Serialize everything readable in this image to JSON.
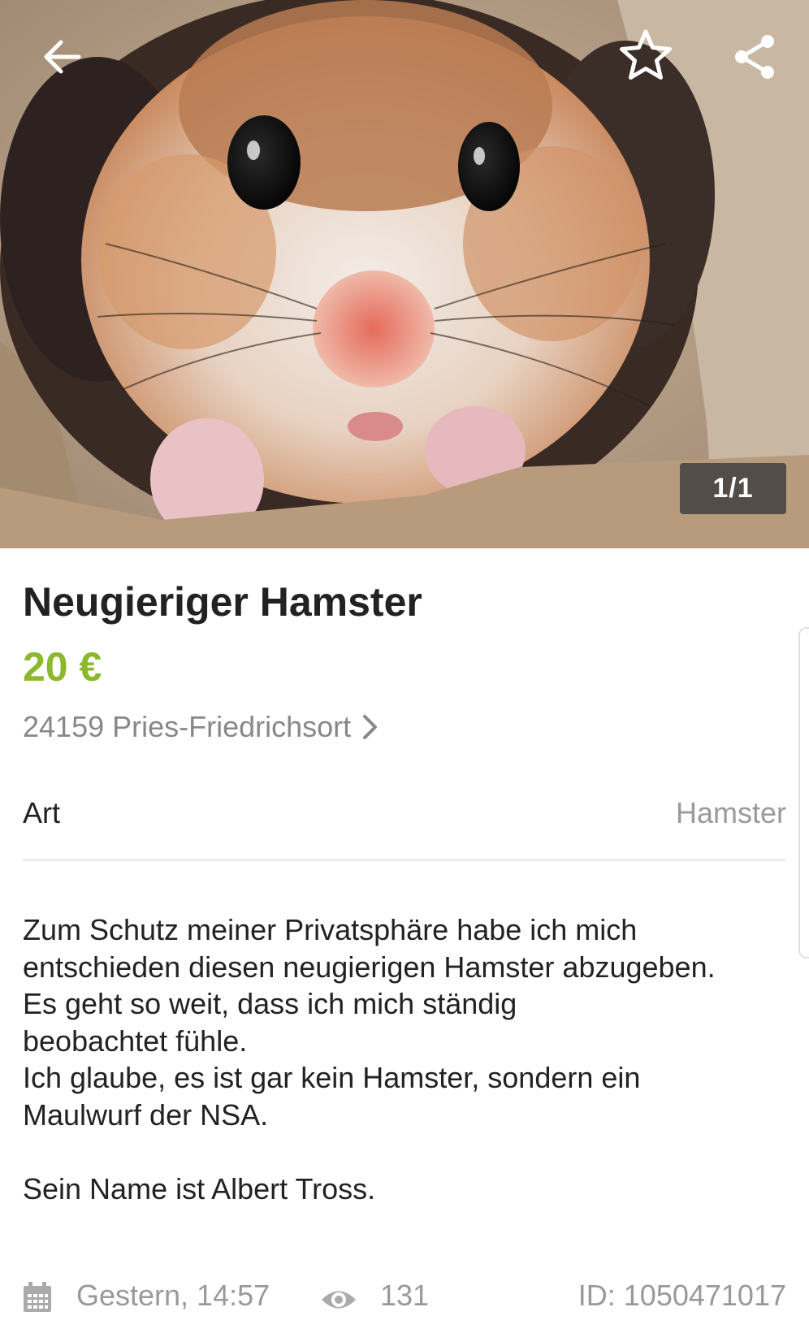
{
  "hero": {
    "image_counter": "1/1"
  },
  "icons": {
    "back": "arrow-left-icon",
    "favorite": "star-outline-icon",
    "share": "share-icon",
    "location_chevron": "chevron-right-icon",
    "date": "calendar-icon",
    "views": "eye-icon"
  },
  "listing": {
    "title": "Neugieriger Hamster",
    "price": "20 €",
    "location": "24159 Pries-Friedrichsort",
    "attribute": {
      "label": "Art",
      "value": "Hamster"
    },
    "description": {
      "lines": [
        "Zum Schutz meiner Privatsphäre habe ich mich",
        "entschieden diesen neugierigen Hamster abzugeben.",
        "Es geht so weit, dass ich mich ständig",
        "beobachtet fühle.",
        "Ich glaube, es ist gar kein Hamster, sondern ein",
        "Maulwurf der NSA.",
        "",
        "Sein Name ist Albert Tross."
      ]
    }
  },
  "footer": {
    "date": "Gestern, 14:57",
    "views": "131",
    "ad_id": "ID: 1050471017"
  },
  "colors": {
    "price": "#8cb82b",
    "title": "#222222",
    "muted": "#999999",
    "divider": "#e6e6e6"
  }
}
